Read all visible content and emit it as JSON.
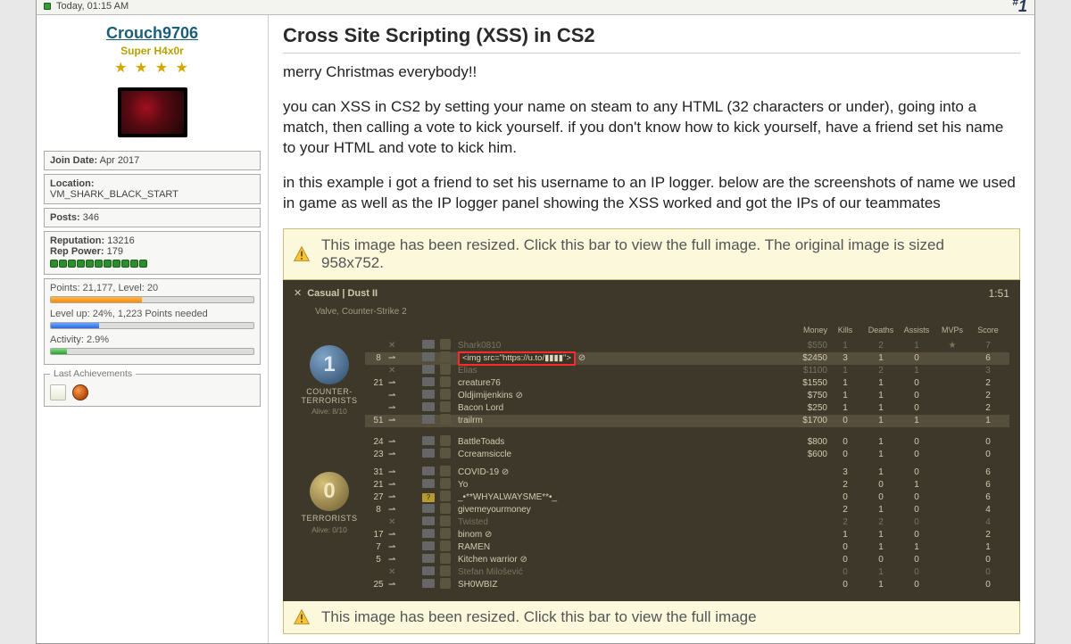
{
  "postbar": {
    "timestamp": "Today, 01:15 AM",
    "post_number_prefix": "#",
    "post_number": "1"
  },
  "user": {
    "name": "Crouch9706",
    "title": "Super H4x0r",
    "join_label": "Join Date:",
    "join_value": "Apr 2017",
    "location_label": "Location:",
    "location_value": "VM_SHARK_BLACK_START",
    "posts_label": "Posts:",
    "posts_value": "346",
    "reputation_label": "Reputation:",
    "reputation_value": "13216",
    "reppower_label": "Rep Power:",
    "reppower_value": "179",
    "points_line": "Points: 21,177, Level: 20",
    "levelup_line": "Level up: 24%, 1,223 Points needed",
    "activity_line": "Activity: 2.9%",
    "achievements_label": "Last Achievements"
  },
  "post": {
    "title": "Cross Site Scripting (XSS) in CS2",
    "p1": "merry Christmas everybody!!",
    "p2": "you can XSS in CS2 by setting your name on steam to any HTML (32 characters or under), going into a match, then calling a vote to kick yourself. if you don't know how to kick yourself, have a friend set his name to your HTML and vote to kick him.",
    "p3": "in this example i got a friend to set his username to an IP logger. below are the screenshots of name we used in game as well as the IP logger panel showing the XSS worked and got the IPs of our teammates"
  },
  "resize": {
    "text1": "This image has been resized. Click this bar to view the full image. The original image is sized 958x752.",
    "text2": "This image has been resized. Click this bar to view the full image"
  },
  "shot": {
    "mode": "Casual | Dust II",
    "subtitle": "Valve, Counter-Strike 2",
    "clock": "1:51",
    "head": {
      "money": "Money",
      "kills": "Kills",
      "deaths": "Deaths",
      "assists": "Assists",
      "mvps": "MVPs",
      "score": "Score"
    },
    "ct": {
      "label1": "COUNTER-",
      "label2": "TERRORISTS",
      "alive": "Alive: 8/10",
      "num": "1"
    },
    "t": {
      "label1": "TERRORISTS",
      "alive": "Alive: 0/10",
      "num": "0"
    },
    "ct_rows": [
      {
        "ping": "",
        "name": "Shark0810",
        "money": "$550",
        "k": "1",
        "d": "2",
        "a": "1",
        "mvp": "★",
        "s": "7",
        "dead": true
      },
      {
        "ping": "8",
        "name": "<img src=\"https://u.to/▮▮▮▮\">",
        "money": "$2450",
        "k": "3",
        "d": "1",
        "a": "0",
        "s": "6",
        "hl": true,
        "boxed": true
      },
      {
        "ping": "",
        "name": "Elias",
        "money": "$1100",
        "k": "1",
        "d": "2",
        "a": "1",
        "s": "3",
        "dead": true
      },
      {
        "ping": "21",
        "name": "creature76",
        "money": "$1550",
        "k": "1",
        "d": "1",
        "a": "0",
        "s": "2"
      },
      {
        "ping": "",
        "name": "Oldjimijenkins ⊘",
        "money": "$750",
        "k": "1",
        "d": "1",
        "a": "0",
        "s": "2"
      },
      {
        "ping": "",
        "name": "Bacon Lord",
        "money": "$250",
        "k": "1",
        "d": "1",
        "a": "0",
        "s": "2"
      },
      {
        "ping": "51",
        "name": "trailrm",
        "money": "$1700",
        "k": "0",
        "d": "1",
        "a": "1",
        "s": "1",
        "hl": true
      },
      {
        "ping": "24",
        "name": "BattleToads",
        "money": "$800",
        "k": "0",
        "d": "1",
        "a": "0",
        "s": "0"
      },
      {
        "ping": "23",
        "name": "Ccreamsiccle",
        "money": "$600",
        "k": "0",
        "d": "1",
        "a": "0",
        "s": "0"
      }
    ],
    "t_rows": [
      {
        "ping": "31",
        "name": "COVID-19 ⊘",
        "k": "3",
        "d": "1",
        "a": "0",
        "s": "6"
      },
      {
        "ping": "21",
        "name": "Yo",
        "k": "2",
        "d": "0",
        "a": "1",
        "s": "6"
      },
      {
        "ping": "27",
        "name": "_•**WHYALWAYSME**•_",
        "k": "0",
        "d": "0",
        "a": "0",
        "s": "6",
        "q": true
      },
      {
        "ping": "8",
        "name": "givemeyourmoney",
        "k": "2",
        "d": "1",
        "a": "0",
        "s": "4"
      },
      {
        "ping": "",
        "name": "Twisted",
        "k": "2",
        "d": "2",
        "a": "0",
        "s": "4",
        "dead": true
      },
      {
        "ping": "17",
        "name": "binom ⊘",
        "k": "1",
        "d": "1",
        "a": "0",
        "s": "2"
      },
      {
        "ping": "7",
        "name": "RAMEN",
        "k": "0",
        "d": "1",
        "a": "1",
        "s": "1"
      },
      {
        "ping": "5",
        "name": "Kitchen warrior ⊘",
        "k": "0",
        "d": "0",
        "a": "0",
        "s": "0"
      },
      {
        "ping": "",
        "name": "Stefan Milošević",
        "k": "0",
        "d": "1",
        "a": "0",
        "s": "0",
        "dead": true
      },
      {
        "ping": "25",
        "name": "SH0WBIZ",
        "k": "0",
        "d": "1",
        "a": "0",
        "s": "0"
      }
    ]
  }
}
